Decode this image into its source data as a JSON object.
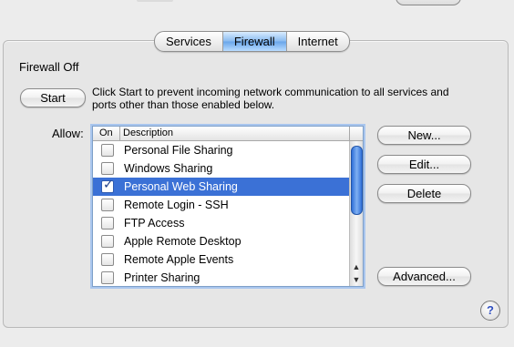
{
  "tabs": [
    {
      "label": "Services",
      "active": false
    },
    {
      "label": "Firewall",
      "active": true
    },
    {
      "label": "Internet",
      "active": false
    }
  ],
  "status": "Firewall Off",
  "start_button": "Start",
  "description": "Click Start to prevent incoming network communication to all services and ports other than those enabled below.",
  "allow_label": "Allow:",
  "list": {
    "header_on": "On",
    "header_description": "Description",
    "items": [
      {
        "label": "Personal File Sharing",
        "checked": false,
        "selected": false
      },
      {
        "label": "Windows Sharing",
        "checked": false,
        "selected": false
      },
      {
        "label": "Personal Web Sharing",
        "checked": true,
        "selected": true
      },
      {
        "label": "Remote Login - SSH",
        "checked": false,
        "selected": false
      },
      {
        "label": "FTP Access",
        "checked": false,
        "selected": false
      },
      {
        "label": "Apple Remote Desktop",
        "checked": false,
        "selected": false
      },
      {
        "label": "Remote Apple Events",
        "checked": false,
        "selected": false
      },
      {
        "label": "Printer Sharing",
        "checked": false,
        "selected": false
      }
    ]
  },
  "buttons": {
    "new": "New...",
    "edit": "Edit...",
    "delete": "Delete",
    "advanced": "Advanced..."
  },
  "help": "?",
  "colors": {
    "selection": "#3b71d6",
    "tab_active": "#6aa6ea"
  }
}
